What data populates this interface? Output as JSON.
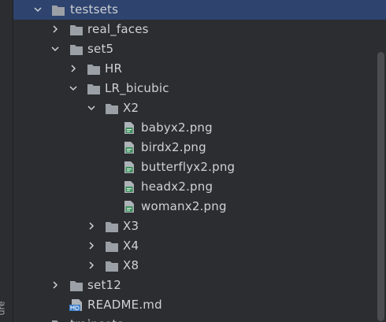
{
  "panel": {
    "side_tab_label": "ure"
  },
  "tree": {
    "testsets": "testsets",
    "real_faces": "real_faces",
    "set5": "set5",
    "hr": "HR",
    "lr_bicubic": "LR_bicubic",
    "x2": "X2",
    "files": [
      "babyx2.png",
      "birdx2.png",
      "butterflyx2.png",
      "headx2.png",
      "womanx2.png"
    ],
    "x3": "X3",
    "x4": "X4",
    "x8": "X8",
    "set12": "set12",
    "readme": "README.md",
    "next_partial": "trainsets"
  },
  "colors": {
    "selected_bg": "#2e436e",
    "folder": "#9aa0a6",
    "png_icon": "#3f8f5f",
    "md_icon": "#3d7ec9"
  }
}
